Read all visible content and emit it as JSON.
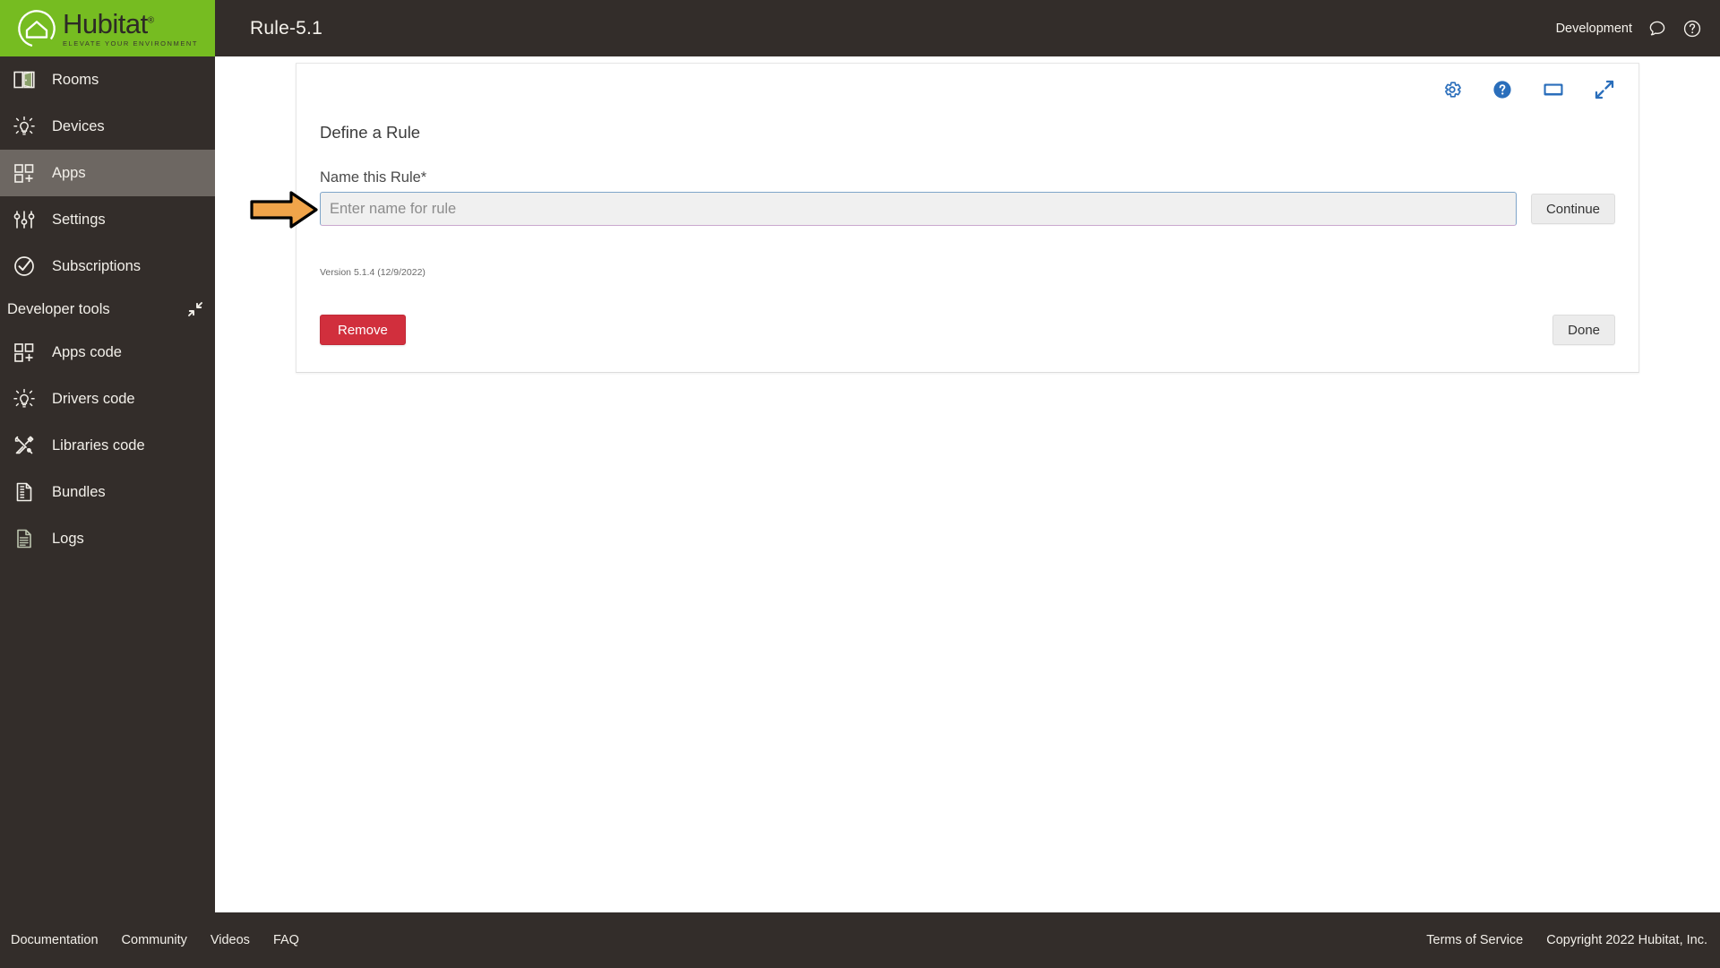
{
  "brand": {
    "name": "Hubitat",
    "trademark": "®",
    "tagline": "ELEVATE YOUR ENVIRONMENT",
    "green": "#76bc21",
    "dark": "#332d2a"
  },
  "topbar": {
    "title": "Rule-5.1",
    "environment": "Development",
    "chat_icon": "chat-bubble-icon",
    "help_icon": "help-circle-icon"
  },
  "sidebar": {
    "items": [
      {
        "label": "Rooms",
        "icon": "rooms-icon",
        "active": false
      },
      {
        "label": "Devices",
        "icon": "device-bulb-icon",
        "active": false
      },
      {
        "label": "Apps",
        "icon": "apps-grid-icon",
        "active": true
      },
      {
        "label": "Settings",
        "icon": "sliders-icon",
        "active": false
      },
      {
        "label": "Subscriptions",
        "icon": "check-circle-icon",
        "active": false
      }
    ],
    "developer_section": {
      "label": "Developer tools",
      "collapse_icon": "collapse-arrows-icon",
      "items": [
        {
          "label": "Apps code",
          "icon": "apps-grid-icon"
        },
        {
          "label": "Drivers code",
          "icon": "device-bulb-icon"
        },
        {
          "label": "Libraries code",
          "icon": "tools-icon"
        },
        {
          "label": "Bundles",
          "icon": "zip-file-icon"
        },
        {
          "label": "Logs",
          "icon": "document-lines-icon"
        }
      ]
    }
  },
  "card": {
    "icons": [
      {
        "name": "gear-icon",
        "color": "#2a6ebb"
      },
      {
        "name": "help-circle-icon",
        "color": "#2a6ebb"
      },
      {
        "name": "display-monitor-icon",
        "color": "#2a6ebb"
      },
      {
        "name": "expand-arrows-icon",
        "color": "#2a6ebb"
      }
    ],
    "title": "Define a Rule",
    "field_label": "Name this Rule*",
    "input_value": "",
    "input_placeholder": "Enter name for rule",
    "continue_label": "Continue",
    "version": "Version 5.1.4 (12/9/2022)",
    "remove_label": "Remove",
    "done_label": "Done",
    "remove_color": "#d12f3d"
  },
  "annotation": {
    "arrow": "orange-right-arrow-annotation",
    "fill": "#f0a44a",
    "stroke": "#000000"
  },
  "footer": {
    "links": [
      "Documentation",
      "Community",
      "Videos",
      "FAQ"
    ],
    "terms": "Terms of Service",
    "copyright": "Copyright 2022 Hubitat, Inc."
  }
}
